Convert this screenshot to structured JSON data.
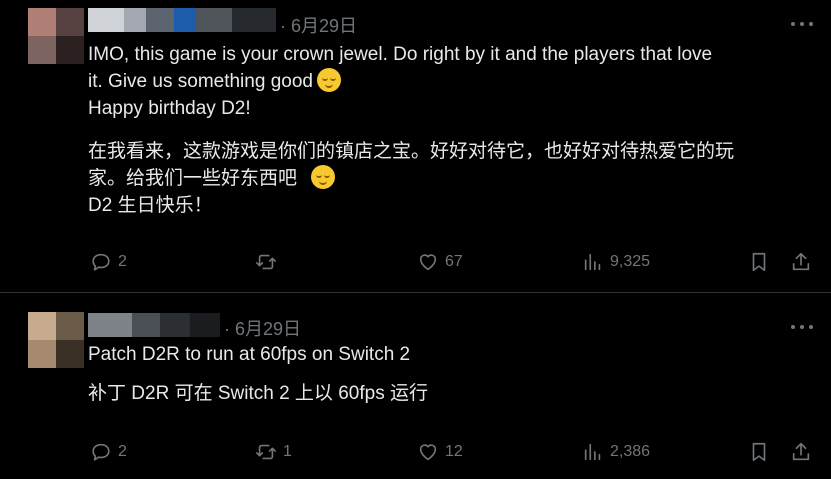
{
  "tweets": [
    {
      "date": "· 6月29日",
      "lines_en": [
        "IMO, this game is your crown jewel. Do right by it and the players that love",
        "it. Give us something good",
        "Happy birthday D2!"
      ],
      "lines_zh": [
        "在我看来，这款游戏是你们的镇店之宝。好好对待它，也好好对待热爱它的玩",
        "家。给我们一些好东西吧",
        "D2 生日快乐！"
      ],
      "replies": "2",
      "reposts": "",
      "likes": "67",
      "views": "9,325"
    },
    {
      "date": "· 6月29日",
      "lines_en": [
        "Patch D2R to run at 60fps on Switch 2"
      ],
      "lines_zh": [
        "补丁 D2R 可在 Switch 2 上以 60fps 运行"
      ],
      "replies": "2",
      "reposts": "1",
      "likes": "12",
      "views": "2,386"
    }
  ],
  "icons": {
    "reply": "reply-icon",
    "repost": "repost-icon",
    "like": "heart-icon",
    "views": "views-icon",
    "bookmark": "bookmark-icon",
    "share": "share-icon",
    "more": "more-icon",
    "emoji": "relieved-face-emoji"
  },
  "colors": {
    "background": "#000000",
    "text": "#e7e9ea",
    "muted": "#71767b",
    "divider": "#2f3336"
  }
}
